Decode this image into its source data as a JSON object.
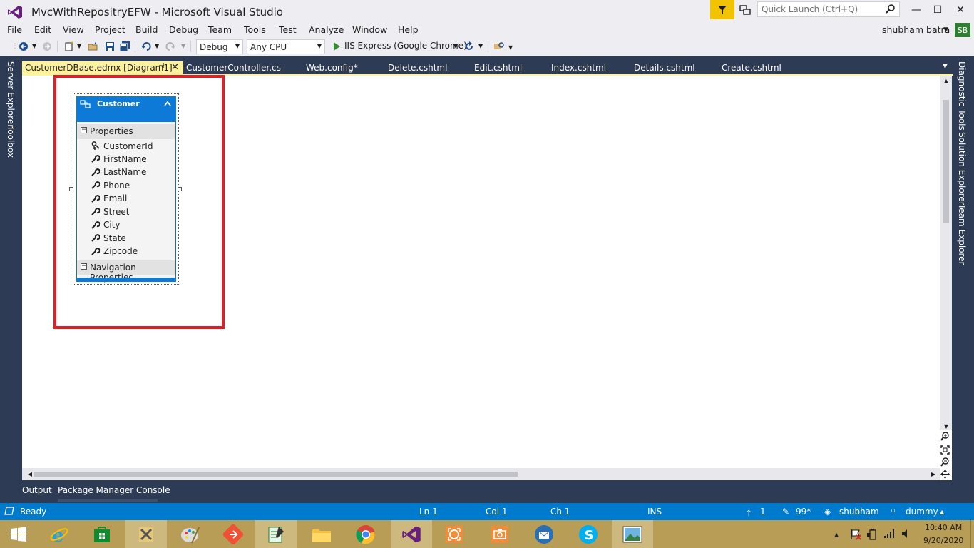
{
  "window": {
    "title": "MvcWithRepositryEFW - Microsoft Visual Studio",
    "quick_launch_placeholder": "Quick Launch (Ctrl+Q)",
    "controls": [
      "—",
      "☐",
      "✕"
    ]
  },
  "menu": [
    "File",
    "Edit",
    "View",
    "Project",
    "Build",
    "Debug",
    "Team",
    "Tools",
    "Test",
    "Analyze",
    "Window",
    "Help"
  ],
  "user": {
    "name": "shubham batra",
    "initials": "SB"
  },
  "toolbar": {
    "configuration": "Debug",
    "platform": "Any CPU",
    "run_target": "IIS Express (Google Chrome)"
  },
  "left_rail": [
    "Server Explorer",
    "Toolbox"
  ],
  "right_rail": [
    "Diagnostic Tools",
    "Solution Explorer",
    "Team Explorer"
  ],
  "tabs": {
    "active": "CustomerDBase.edmx [Diagram1]",
    "others": [
      "CustomerController.cs",
      "Web.config*",
      "Delete.cshtml",
      "Edit.cshtml",
      "Index.cshtml",
      "Details.cshtml",
      "Create.cshtml"
    ]
  },
  "entity": {
    "name": "Customer",
    "properties_header": "Properties",
    "properties": [
      "CustomerId",
      "FirstName",
      "LastName",
      "Phone",
      "Email",
      "Street",
      "City",
      "State",
      "Zipcode"
    ],
    "key_property": "CustomerId",
    "navigation_header": "Navigation Properties"
  },
  "bottom_tabs": [
    "Output",
    "Package Manager Console"
  ],
  "status": {
    "state": "Ready",
    "ln": "Ln 1",
    "col": "Col 1",
    "ch": "Ch 1",
    "mode": "INS",
    "pushes": "1",
    "changes": "99*",
    "repo_user": "shubham",
    "branch": "dummy"
  },
  "taskbar": {
    "apps": [
      "start",
      "internet-explorer",
      "store",
      "tools",
      "paint",
      "git",
      "notepad",
      "file-explorer",
      "chrome",
      "visual-studio",
      "capture",
      "camera",
      "thunderbird",
      "skype",
      "photos"
    ],
    "time": "10:40 AM",
    "date": "9/20/2020"
  },
  "colors": {
    "accent": "#007acc",
    "highlight": "#e41e26",
    "active_tab": "#fff29d",
    "entity_header": "#0c7ad6",
    "taskbar": "#b79d55"
  }
}
